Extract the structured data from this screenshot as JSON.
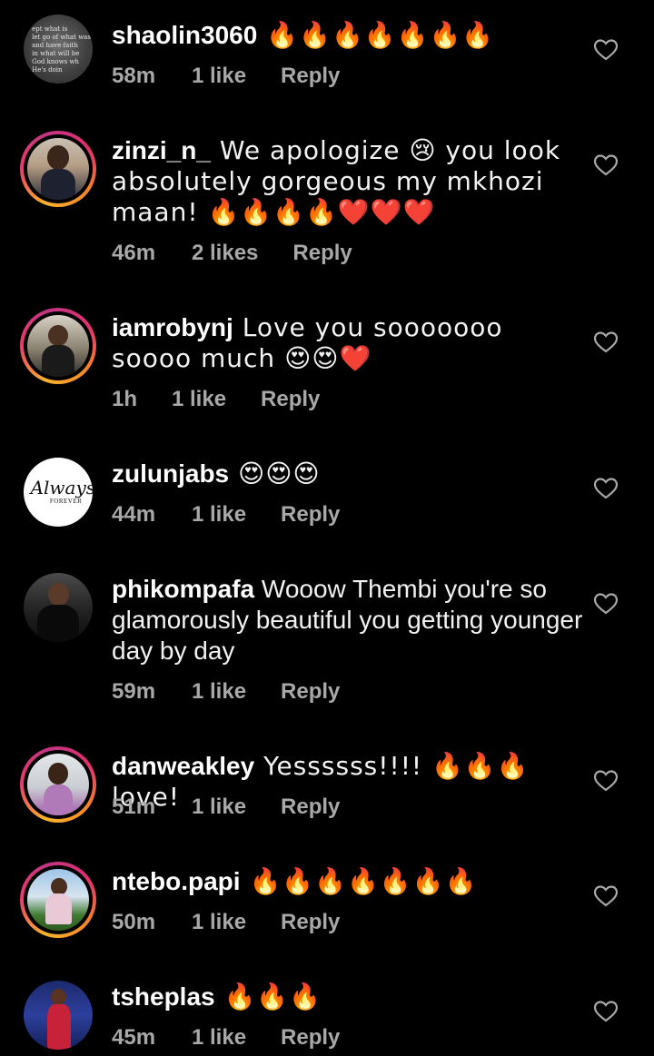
{
  "comments": [
    {
      "username": "shaolin3060",
      "text": " 🔥🔥🔥🔥🔥🔥🔥",
      "time": "58m",
      "likes": "1 like",
      "reply": "Reply",
      "avatar": "quote-image",
      "avatar_text": [
        "ept what is",
        "let go of what was",
        "and have faith",
        "in what will be",
        "God knows wh",
        "He's doin"
      ]
    },
    {
      "username": "zinzi_n_",
      "text": " We apologize 😢 you look absolutely gorgeous my mkhozi maan! 🔥🔥🔥🔥❤️❤️❤️",
      "time": "46m",
      "likes": "2 likes",
      "reply": "Reply",
      "avatar": "woman-portrait"
    },
    {
      "username": "iamrobynj",
      "text": " Love you sooooooo soooo much 😍😍❤️",
      "time": "1h",
      "likes": "1 like",
      "reply": "Reply",
      "avatar": "person-portrait"
    },
    {
      "username": "zulunjabs",
      "text": " 😍😍😍",
      "time": "44m",
      "likes": "1 like",
      "reply": "Reply",
      "avatar": "always-forever-logo",
      "avatar_text": [
        "Always",
        "FOREVER"
      ]
    },
    {
      "username": "phikompafa",
      "text": " Wooow Thembi you're so glamorously beautiful you getting younger day by day",
      "time": "59m",
      "likes": "1 like",
      "reply": "Reply",
      "avatar": "man-portrait"
    },
    {
      "username": "danweakley",
      "text": " Yessssss!!!! 🔥🔥🔥 love!",
      "time": "51m",
      "likes": "1 like",
      "reply": "Reply",
      "avatar": "woman-portrait"
    },
    {
      "username": "ntebo.papi",
      "text": " 🔥🔥🔥🔥🔥🔥🔥",
      "time": "50m",
      "likes": "1 like",
      "reply": "Reply",
      "avatar": "outdoor-portrait"
    },
    {
      "username": "tsheplas",
      "text": " 🔥🔥🔥",
      "time": "45m",
      "likes": "1 like",
      "reply": "Reply",
      "avatar": "red-dress-portrait"
    }
  ],
  "colors": {
    "background": "#000000",
    "text": "#f2f2f2",
    "meta": "#a8a8a8",
    "story_ring": "#e1306c"
  },
  "icons": {
    "like": "heart-outline-icon"
  }
}
